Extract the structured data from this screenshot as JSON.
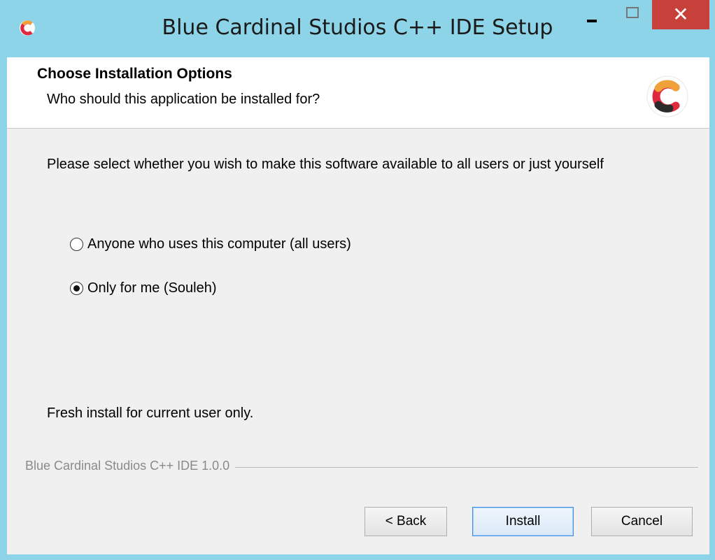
{
  "window": {
    "title": "Blue Cardinal Studios C++ IDE Setup",
    "minimize_label": "–",
    "close_label": "✕"
  },
  "header": {
    "title": "Choose Installation Options",
    "subtitle": "Who should this application be installed for?",
    "logo_icon": "cpp-logo-icon"
  },
  "content": {
    "instruction": "Please select whether you wish to make this software available to all users or just yourself",
    "options": [
      {
        "label": "Anyone who uses this computer (all users)",
        "checked": false
      },
      {
        "label": "Only for me (Souleh)",
        "checked": true
      }
    ],
    "status": "Fresh install for current user only.",
    "brand": "Blue Cardinal Studios C++ IDE 1.0.0"
  },
  "buttons": {
    "back": "< Back",
    "install": "Install",
    "cancel": "Cancel"
  },
  "colors": {
    "titlebar": "#8ed4e8",
    "close": "#c8403a",
    "logo_red": "#e0293f",
    "logo_orange": "#f0a23a",
    "logo_dark": "#2a2a2a"
  }
}
